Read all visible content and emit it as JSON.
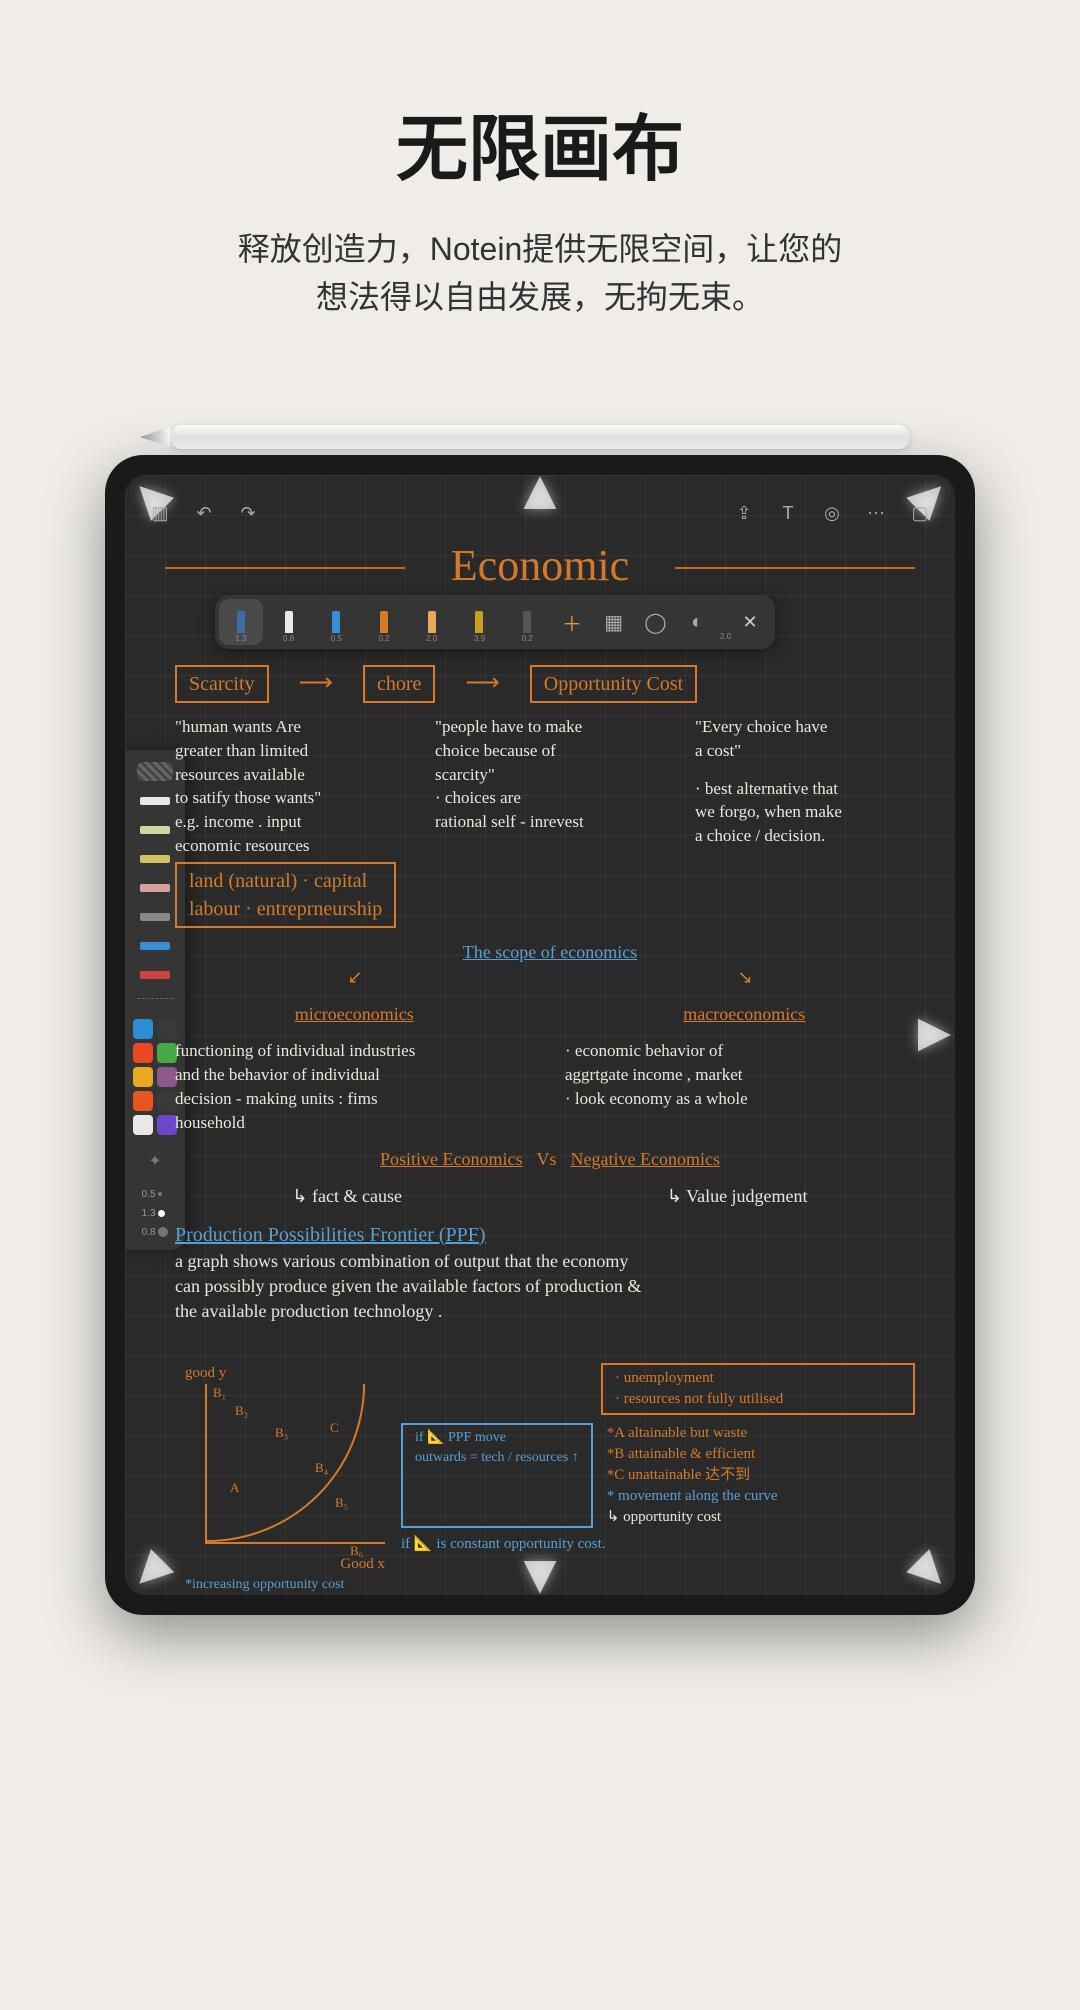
{
  "promo": {
    "title": "无限画布",
    "subtitle_l1": "释放创造力，Notein提供无限空间，让您的",
    "subtitle_l2": "想法得以自由发展，无拘无束。"
  },
  "canvas": {
    "title": "Economic"
  },
  "h_toolbar": {
    "pens": [
      {
        "color": "#3a6ea5",
        "size": "1.3",
        "selected": true
      },
      {
        "color": "#e8e8e8",
        "size": "0.8"
      },
      {
        "color": "#3a8fd4",
        "size": "0.5"
      },
      {
        "color": "#d47a2a",
        "size": "0.2"
      },
      {
        "color": "#e8a85a",
        "size": "2.0"
      },
      {
        "color": "#c5a020",
        "size": "3.9"
      },
      {
        "color": "#555",
        "size": "0.2"
      }
    ],
    "tail_size": "2.0"
  },
  "v_toolbar": {
    "tools": [
      {
        "name": "pen-white",
        "color": "#e8e8e8"
      },
      {
        "name": "pen-cream",
        "color": "#d4d4a0"
      },
      {
        "name": "highlighter",
        "color": "#d4c060"
      },
      {
        "name": "pen-pink",
        "color": "#d4a0a0"
      },
      {
        "name": "pen-thin",
        "color": "#888"
      },
      {
        "name": "pen-blue",
        "color": "#3a8fd4"
      },
      {
        "name": "eraser",
        "color": "#cc4444"
      }
    ],
    "palette": [
      "#2a8fd4",
      "#3a3a3a",
      "#e84822",
      "#48a848",
      "#e8a820",
      "#8a5a8a",
      "#e85522",
      "#3a3a3a",
      "#e8e8e8",
      "#6a48c8"
    ],
    "sizes": [
      "0.5",
      "1.3",
      "0.8"
    ]
  },
  "notes": {
    "row1": {
      "a": "Scarcity",
      "b": "chore",
      "c": "Opportunity  Cost"
    },
    "col1": {
      "t1": "\"human wants Are",
      "t2": "greater than limited",
      "t3": "resources available",
      "t4": "to satify those wants\"",
      "t5": "e.g. income . input",
      "t6": "economic resources",
      "t7": "land (natural) · capital",
      "t8": "labour · entreprneurship"
    },
    "col2": {
      "t1": "\"people have to make",
      "t2": "choice because of",
      "t3": "scarcity\"",
      "t4": "· choices are",
      "t5": "rational self - inrevest"
    },
    "col3": {
      "t1": "\"Every choice  have",
      "t2": "a cost\"",
      "t3": "· best alternative that",
      "t4": "we forgo, when make",
      "t5": "a choice / decision."
    },
    "scope": "The  scope  of economics",
    "micro": "microeconomics",
    "macro": "macroeconomics",
    "micro_body": {
      "t1": "functioning of individual  industries",
      "t2": "and  the  behavior  of  individual",
      "t3": "decision - making  units :  fims",
      "t4": "household"
    },
    "macro_body": {
      "t1": "· economic  behavior of",
      "t2": "aggrtgate income , market",
      "t3": "· look economy as a whole"
    },
    "posneg": {
      "a": "Positive  Economics",
      "vs": "Vs",
      "b": "Negative  Economics"
    },
    "posneg_sub": {
      "a": "↳ fact  &  cause",
      "b": "↳ Value judgement"
    },
    "ppf_title": "Production  Possibilities  Frontier  (PPF)",
    "ppf_body": {
      "t1": "a  graph  shows  various  combination  of  output  that  the  economy",
      "t2": "can  possibly  produce  given  the  available  factors  of  production  &",
      "t3": "the  available  production  technology ."
    },
    "ppf_box1": {
      "t1": "· unemployment",
      "t2": "· resources not fully utilised"
    },
    "ppf_labels": {
      "good_y": "good y",
      "good_x": "Good x",
      "b1": "B₁",
      "b2": "B₂",
      "b3": "B₃",
      "b4": "B₄",
      "b5": "B₅",
      "b6": "B₆",
      "a": "A",
      "c": "C"
    },
    "ppf_if": {
      "t1": "if  📐  PPF  move",
      "t2": "outwards = tech / resources ↑"
    },
    "ppf_legend": {
      "a": "*A  altainable  but  waste",
      "b": "*B  attainable  & efficient",
      "c": "*C  unattainable  达不到",
      "m1": "* movement  along  the curve",
      "m2": "↳ opportunity  cost"
    },
    "ppf_bottom": {
      "t1": "*increasing  opportunity  cost",
      "t2": "if  📐  is constant opportunity cost."
    }
  }
}
